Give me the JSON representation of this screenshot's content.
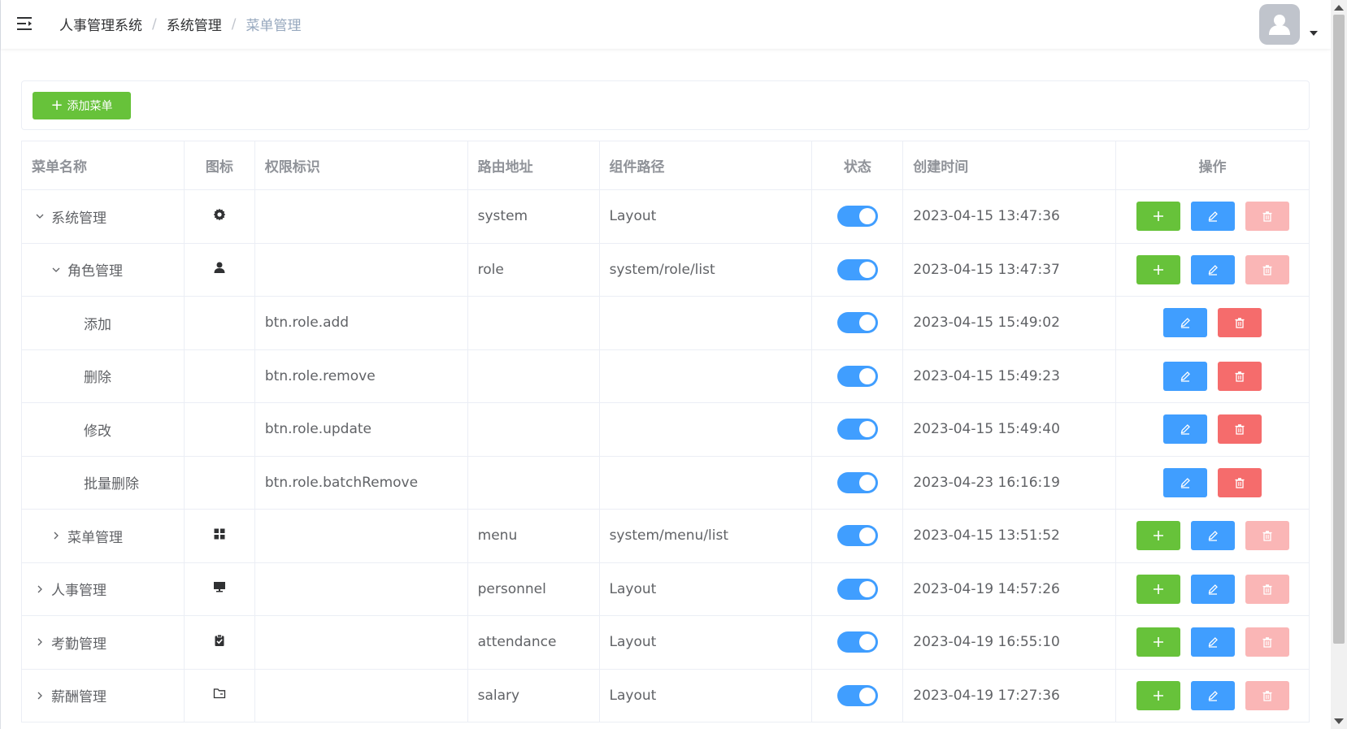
{
  "header": {
    "breadcrumb": [
      "人事管理系统",
      "系统管理",
      "菜单管理"
    ],
    "separator": "/"
  },
  "toolbar": {
    "add_menu_label": "添加菜单"
  },
  "table": {
    "columns": [
      "菜单名称",
      "图标",
      "权限标识",
      "路由地址",
      "组件路径",
      "状态",
      "创建时间",
      "操作"
    ],
    "rows": [
      {
        "name": "系统管理",
        "level": 0,
        "expander": "expanded",
        "icon": "setting-icon",
        "perm": "",
        "route": "system",
        "component": "Layout",
        "enabled": true,
        "created": "2023-04-15 13:47:36",
        "can_add": true,
        "delete_disabled": true
      },
      {
        "name": "角色管理",
        "level": 1,
        "expander": "expanded",
        "icon": "user-icon",
        "perm": "",
        "route": "role",
        "component": "system/role/list",
        "enabled": true,
        "created": "2023-04-15 13:47:37",
        "can_add": true,
        "delete_disabled": true
      },
      {
        "name": "添加",
        "level": 2,
        "expander": "none",
        "icon": "",
        "perm": "btn.role.add",
        "route": "",
        "component": "",
        "enabled": true,
        "created": "2023-04-15 15:49:02",
        "can_add": false,
        "delete_disabled": false
      },
      {
        "name": "删除",
        "level": 2,
        "expander": "none",
        "icon": "",
        "perm": "btn.role.remove",
        "route": "",
        "component": "",
        "enabled": true,
        "created": "2023-04-15 15:49:23",
        "can_add": false,
        "delete_disabled": false
      },
      {
        "name": "修改",
        "level": 2,
        "expander": "none",
        "icon": "",
        "perm": "btn.role.update",
        "route": "",
        "component": "",
        "enabled": true,
        "created": "2023-04-15 15:49:40",
        "can_add": false,
        "delete_disabled": false
      },
      {
        "name": "批量删除",
        "level": 2,
        "expander": "none",
        "icon": "",
        "perm": "btn.role.batchRemove",
        "route": "",
        "component": "",
        "enabled": true,
        "created": "2023-04-23 16:16:19",
        "can_add": false,
        "delete_disabled": false
      },
      {
        "name": "菜单管理",
        "level": 1,
        "expander": "collapsed",
        "icon": "menu-grid-icon",
        "perm": "",
        "route": "menu",
        "component": "system/menu/list",
        "enabled": true,
        "created": "2023-04-15 13:51:52",
        "can_add": true,
        "delete_disabled": true
      },
      {
        "name": "人事管理",
        "level": 0,
        "expander": "collapsed",
        "icon": "monitor-icon",
        "perm": "",
        "route": "personnel",
        "component": "Layout",
        "enabled": true,
        "created": "2023-04-19 14:57:26",
        "can_add": true,
        "delete_disabled": true
      },
      {
        "name": "考勤管理",
        "level": 0,
        "expander": "collapsed",
        "icon": "clipboard-check-icon",
        "perm": "",
        "route": "attendance",
        "component": "Layout",
        "enabled": true,
        "created": "2023-04-19 16:55:10",
        "can_add": true,
        "delete_disabled": true
      },
      {
        "name": "薪酬管理",
        "level": 0,
        "expander": "collapsed",
        "icon": "folder-icon",
        "perm": "",
        "route": "salary",
        "component": "Layout",
        "enabled": true,
        "created": "2023-04-19 17:27:36",
        "can_add": true,
        "delete_disabled": true
      }
    ]
  },
  "colors": {
    "add": "#67c23a",
    "edit": "#409eff",
    "delete": "#f56c6c",
    "delete_disabled": "#fab6b6",
    "switch_on": "#409eff"
  }
}
